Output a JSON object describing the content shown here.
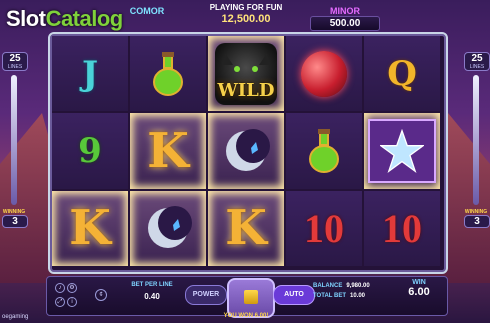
{
  "watermark": {
    "part1": "Slot",
    "part2": "Catalog"
  },
  "jackpots": {
    "major": {
      "label": "COMOR",
      "value": ""
    },
    "minor": {
      "label": "MINOR",
      "value": "500.00"
    }
  },
  "mode": {
    "label": "PLAYING FOR FUN",
    "balance": "12,500.00"
  },
  "lines": {
    "count": "25",
    "caption": "LINES"
  },
  "winning": {
    "caption": "WINNING",
    "count": "3"
  },
  "reels": [
    [
      "J",
      "potion",
      "wild",
      "orb",
      "Q"
    ],
    [
      "9",
      "K",
      "moon",
      "potion",
      "star"
    ],
    [
      "K",
      "moon",
      "K",
      "10",
      "10"
    ]
  ],
  "wild_label": "WILD",
  "bet_per_line": {
    "label": "BET PER LINE",
    "value": "0.40"
  },
  "buttons": {
    "power": "POWER",
    "auto": "AUTO"
  },
  "balance": {
    "label": "BALANCE",
    "value": "9,980.00"
  },
  "total_bet": {
    "label": "TOTAL BET",
    "value": "10.00"
  },
  "win": {
    "label": "WIN",
    "value": "6.00"
  },
  "you_won": "YOU WON 6.00!",
  "provider": "oegaming",
  "colors": {
    "accent": "#6a3ad8",
    "frame": "#c9d6e8",
    "gold": "#f4b236"
  }
}
